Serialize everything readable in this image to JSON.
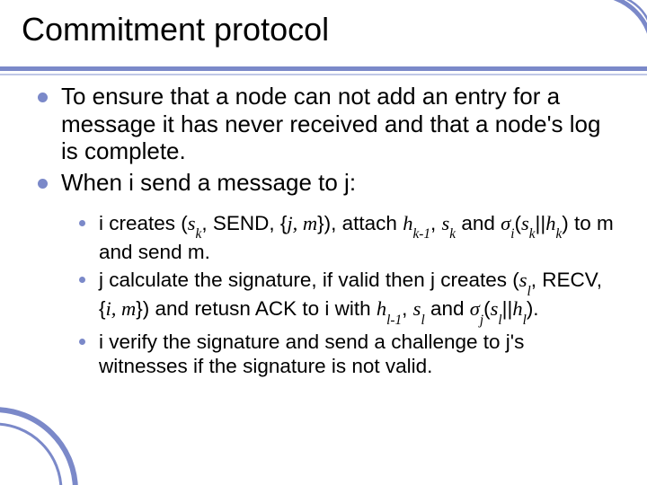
{
  "title": "Commitment protocol",
  "points": {
    "p1": "To ensure that a node can not add an entry for a message it has never received and that a node's log is complete.",
    "p2": "When i send a message to j:"
  },
  "sub": {
    "s1_html": "i creates (<span class='ital'>s<sub>k</sub></span>, SEND, {<span class='ital'>j, m</span>}), attach <span class='ital'>h<sub>k-1</sub></span>, <span class='ital'>s<sub>k</sub></span> and <span class='ital'>σ<sub>i</sub></span>(<span class='ital'>s<sub>k</sub></span>||<span class='ital'>h<sub>k</sub></span>) to m and send m.",
    "s2_html": "j calculate the signature, if valid then j creates (<span class='ital'>s<sub>l</sub></span>, RECV, {<span class='ital'>i, m</span>}) and retusn ACK to i with <span class='ital'>h<sub>l-1</sub></span>, <span class='ital'>s<sub>l</sub></span> and <span class='ital'>σ<sub>j</sub></span>(<span class='ital'>s<sub>l</sub></span>||<span class='ital'>h<sub>l</sub></span>).",
    "s3_html": "i verify the signature and send a challenge to j's witnesses if the signature is not valid."
  },
  "colors": {
    "accent": "#7b89c9",
    "accent_light": "#bfc7e6",
    "text": "#000000",
    "bg": "#ffffff"
  }
}
